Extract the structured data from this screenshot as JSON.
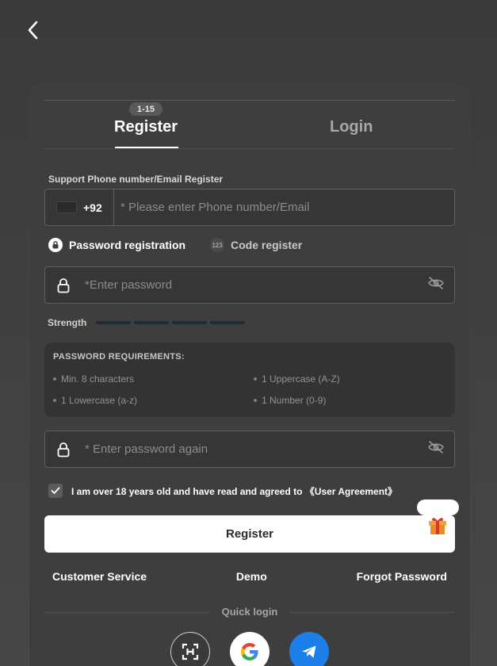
{
  "header": {
    "back_icon": "chevron-left-icon"
  },
  "tabs": {
    "register_label": "Register",
    "login_label": "Login",
    "age_badge": "1-15"
  },
  "form": {
    "support_label": "Support Phone number/Email Register",
    "country_code": "+92",
    "phone_placeholder": "* Please enter Phone number/Email",
    "mode_password": "Password registration",
    "mode_code": "Code register",
    "mode_code_icon_text": "123",
    "password_placeholder": "*Enter password",
    "password_again_placeholder": "* Enter password again",
    "strength_label": "Strength",
    "strength_filled_segments": 0,
    "strength_total_segments": 4
  },
  "requirements": {
    "title": "PASSWORD REQUIREMENTS:",
    "items": [
      "Min. 8 characters",
      "1 Uppercase (A-Z)",
      "1 Lowercase (a-z)",
      "1 Number (0-9)"
    ]
  },
  "agreement": {
    "checked": true,
    "text": "I am over 18 years old and have read and agreed to ",
    "link": "《User Agreement》"
  },
  "actions": {
    "register_button": "Register",
    "customer_service": "Customer Service",
    "demo": "Demo",
    "forgot_password": "Forgot Password",
    "quick_login": "Quick login"
  },
  "social": [
    {
      "name": "scan-icon"
    },
    {
      "name": "google-icon"
    },
    {
      "name": "telegram-icon"
    }
  ],
  "colors": {
    "background": "#3b3b3b",
    "card": "#3e3e3e",
    "primary_button": "#ffffff",
    "telegram": "#1c7ee8",
    "strength_segment": "#1f2b3a"
  }
}
